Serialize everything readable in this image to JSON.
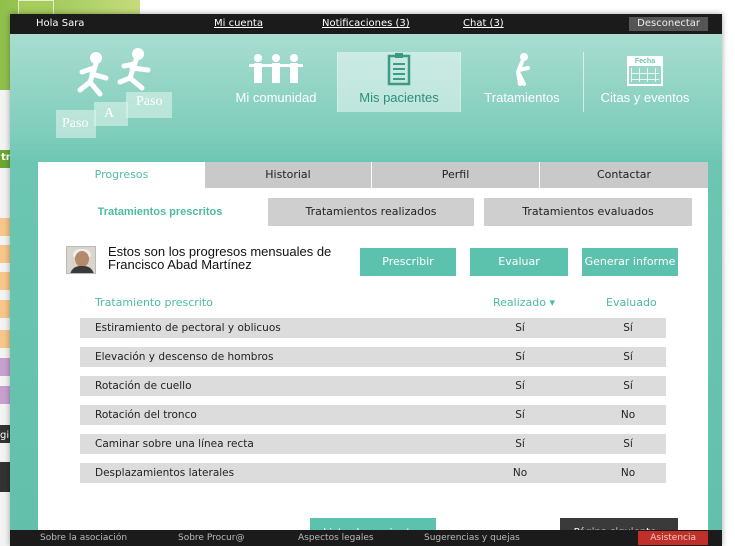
{
  "topbar": {
    "greeting": "Hola Sara",
    "links": [
      "Mi cuenta",
      "Notificaciones (3)",
      "Chat (3)"
    ],
    "logout": "Desconectar"
  },
  "logo": {
    "words": [
      "Paso",
      "A",
      "Paso"
    ]
  },
  "nav": [
    {
      "label": "Mi comunidad",
      "icon": "community-icon",
      "active": false
    },
    {
      "label": "Mis pacientes",
      "icon": "clipboard-icon",
      "active": true
    },
    {
      "label": "Tratamientos",
      "icon": "exercise-icon",
      "active": false
    },
    {
      "label": "Citas y eventos",
      "icon": "calendar-icon",
      "active": false,
      "icon_title": "Fecha"
    }
  ],
  "tabs": [
    "Progresos",
    "Historial",
    "Perfil",
    "Contactar"
  ],
  "active_tab": "Progresos",
  "subtabs": [
    "Tratamientos prescritos",
    "Tratamientos realizados",
    "Tratamientos evaluados"
  ],
  "patient_intro": "Estos son los progresos mensuales de Francisco Abad Martínez",
  "actions": {
    "prescribe": "Prescribir",
    "evaluate": "Evaluar",
    "report": "Generar informe"
  },
  "table": {
    "headers": [
      "Tratamiento prescrito",
      "Realizado ▾",
      "Evaluado"
    ],
    "rows": [
      [
        "Estiramiento de pectoral y oblicuos",
        "Sí",
        "Sí"
      ],
      [
        "Elevación y descenso de hombros",
        "Sí",
        "Sí"
      ],
      [
        "Rotación de cuello",
        "Sí",
        "Sí"
      ],
      [
        "Rotación del tronco",
        "Sí",
        "No"
      ],
      [
        "Caminar sobre una línea recta",
        "Sí",
        "Sí"
      ],
      [
        "Desplazamientos laterales",
        "No",
        "No"
      ]
    ]
  },
  "buttons": {
    "list": "Lista de pacientes",
    "next": "Página siguiente ▸"
  },
  "footer": {
    "links": [
      "Sobre la asociación",
      "Sobre Procur@",
      "Aspectos legales",
      "Sugerencias y quejas"
    ],
    "assist": "Asistencia"
  },
  "background_window": {
    "fragments": [
      "tr",
      "gi"
    ]
  },
  "colors": {
    "accent": "#5cc2ad",
    "header": "#6cc6b1",
    "dark": "#1b1b1b",
    "alert": "#c0302a"
  }
}
